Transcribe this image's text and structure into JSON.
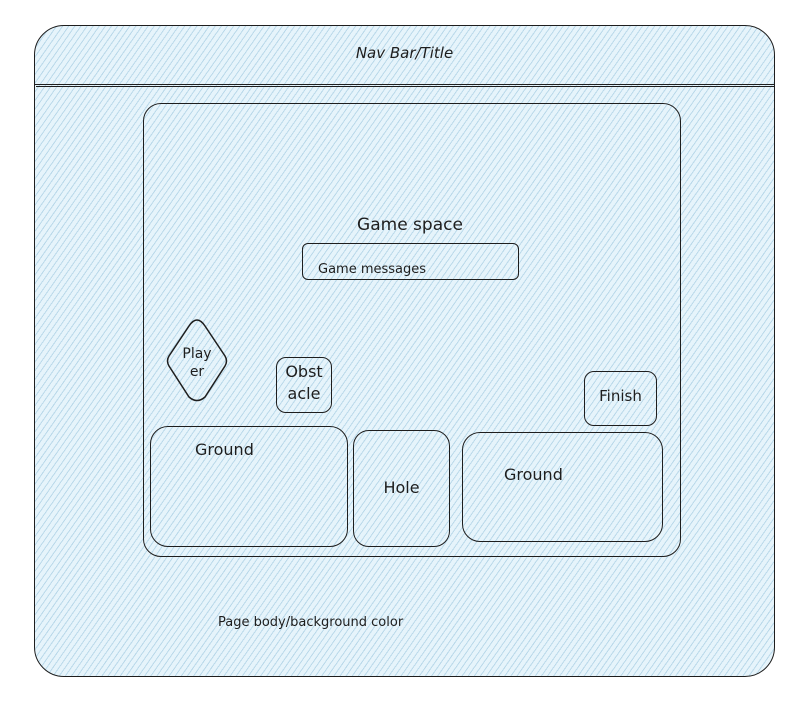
{
  "nav": {
    "title": "Nav Bar/Title"
  },
  "game": {
    "title": "Game space",
    "messages_label": "Game messages",
    "player_label": "Play\ner",
    "obstacle_label": "Obst\nacle",
    "finish_label": "Finish",
    "ground_left_label": "Ground",
    "hole_label": "Hole",
    "ground_right_label": "Ground"
  },
  "page": {
    "body_label": "Page body/background color"
  },
  "colors": {
    "fill": "#e6f4fb",
    "hatch": "#96c3dc",
    "stroke": "#1e1e1e"
  }
}
